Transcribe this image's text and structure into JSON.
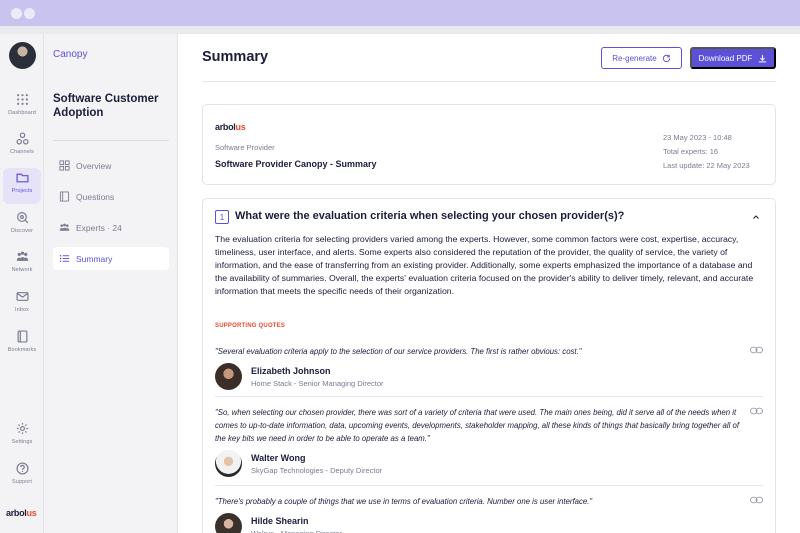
{
  "rail": {
    "items": [
      {
        "label": "Dashboard",
        "icon": "grid-icon"
      },
      {
        "label": "Channels",
        "icon": "channels-icon"
      },
      {
        "label": "Projects",
        "icon": "folder-icon"
      },
      {
        "label": "Discover",
        "icon": "discover-icon"
      },
      {
        "label": "Network",
        "icon": "network-icon"
      },
      {
        "label": "Inbox",
        "icon": "mail-icon"
      },
      {
        "label": "Bookmarks",
        "icon": "bookmark-icon"
      },
      {
        "label": "Settings",
        "icon": "gear-icon"
      },
      {
        "label": "Support",
        "icon": "help-icon"
      }
    ],
    "logo": {
      "a": "arbol",
      "b": "us"
    }
  },
  "sidebar": {
    "brand": "Canopy",
    "project_title": "Software Customer Adoption",
    "nav": [
      {
        "label": "Overview"
      },
      {
        "label": "Questions"
      },
      {
        "label": "Experts · 24"
      },
      {
        "label": "Summary"
      }
    ]
  },
  "header": {
    "title": "Summary",
    "regenerate_label": "Re-generate",
    "download_label": "Download PDF"
  },
  "info": {
    "logo_a": "arbol",
    "logo_b": "us",
    "subtitle": "Software Provider",
    "title": "Software Provider Canopy - Summary",
    "date": "23 May 2023 - 10:48",
    "experts": "Total experts: 16",
    "updated": "Last update: 22 May 2023"
  },
  "question": {
    "number": "1",
    "title": "What were the evaluation criteria when selecting your chosen provider(s)?",
    "answer": "The evaluation criteria for selecting providers varied among the experts. However, some common factors were cost, expertise, accuracy, timeliness, user interface, and alerts. Some experts also considered the reputation of the provider, the quality of service, the variety of information, and the ease of transferring from an existing provider. Additionally, some experts emphasized the importance of a database and the availability of summaries. Overall, the experts' evaluation criteria focused on the provider's ability to deliver timely, relevant, and accurate information that meets the specific needs of their organization.",
    "supporting_label": "SUPPORTING QUOTES",
    "quotes": [
      {
        "text": "\"Several evaluation criteria apply to the selection of our service providers. The first is rather obvious: cost.\"",
        "name": "Elizabeth Johnson",
        "role": "Home Stack - Senior Managing Director"
      },
      {
        "text": "\"So, when selecting our chosen provider, there was sort of a variety of criteria that were used. The main ones being, did it serve all of the needs when it comes to up-to-date information, data, upcoming events, developments, stakeholder mapping, all these kinds of things that basically bring together all of the key bits we need in order to be able to operate as a team.\"",
        "name": "Walter Wong",
        "role": "SkyGap Technologies - Deputy Director"
      },
      {
        "text": "\"There's probably a couple of things that we use in terms of evaluation criteria. Number one is user interface.\"",
        "name": "Hilde Shearin",
        "role": "Walrus - Managing Director"
      }
    ]
  },
  "colors": {
    "accent": "#5b50d6",
    "highlight": "#e84a2f",
    "text": "#1b1d3b",
    "muted": "#7a7c8f"
  }
}
